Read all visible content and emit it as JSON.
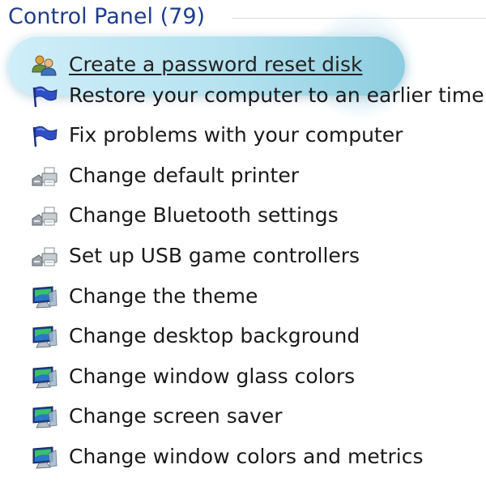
{
  "group": {
    "title": "Control Panel (79)"
  },
  "results": [
    {
      "label": "Create a password reset disk",
      "icon": "users-icon",
      "selected": true
    },
    {
      "label": "Restore your computer to an earlier time",
      "icon": "action-center-flag-icon",
      "selected": false
    },
    {
      "label": "Fix problems with your computer",
      "icon": "action-center-flag-icon",
      "selected": false
    },
    {
      "label": "Change default printer",
      "icon": "devices-printers-icon",
      "selected": false
    },
    {
      "label": "Change Bluetooth settings",
      "icon": "devices-printers-icon",
      "selected": false
    },
    {
      "label": "Set up USB game controllers",
      "icon": "devices-printers-icon",
      "selected": false
    },
    {
      "label": "Change the theme",
      "icon": "personalization-monitor-icon",
      "selected": false
    },
    {
      "label": "Change desktop background",
      "icon": "personalization-monitor-icon",
      "selected": false
    },
    {
      "label": "Change window glass colors",
      "icon": "personalization-monitor-icon",
      "selected": false
    },
    {
      "label": "Change screen saver",
      "icon": "personalization-monitor-icon",
      "selected": false
    },
    {
      "label": "Change window colors and metrics",
      "icon": "personalization-monitor-icon",
      "selected": false
    }
  ],
  "colors": {
    "group_title": "#1f3d8a",
    "selection_highlight": "#b6e2f0",
    "text": "#1a1a1a"
  }
}
